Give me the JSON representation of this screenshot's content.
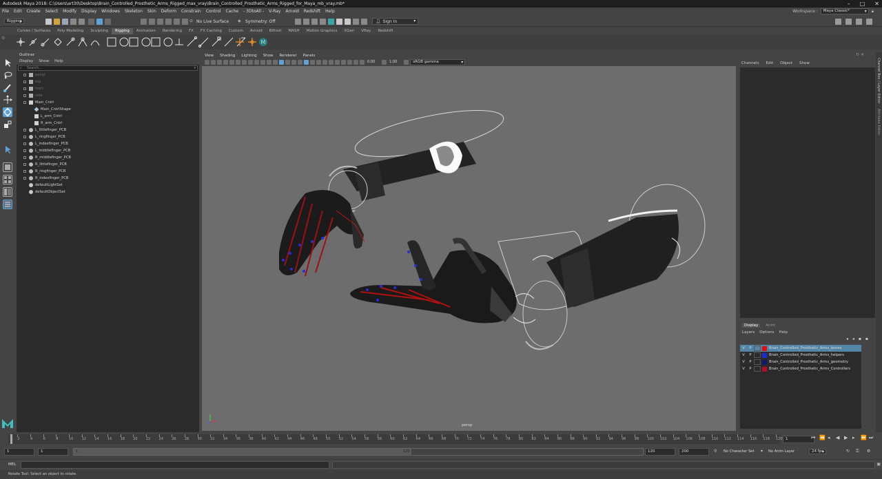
{
  "window": {
    "title": "Autodesk Maya 2018: C:\\Users\\art30\\Desktop\\Brain_Controlled_Prosthetic_Arms_Rigged_max_vray\\Brain_Controlled_Prosthetic_Arms_Rigged_for_Maya_mb_vray.mb*"
  },
  "menus": [
    "File",
    "Edit",
    "Create",
    "Select",
    "Modify",
    "Display",
    "Windows",
    "Skeleton",
    "Skin",
    "Deform",
    "Constrain",
    "Control",
    "Cache",
    "- 3DtoAll -",
    "V-Ray",
    "Arnold",
    "Redshift",
    "Help"
  ],
  "workspace": {
    "label": "Workspace :",
    "value": "Maya Classic*"
  },
  "status_line": {
    "menu_set": "Rigging",
    "live_surface": "No Live Surface",
    "symmetry": "Symmetry: Off",
    "sign_in": "Sign In"
  },
  "shelf_tabs": [
    "Curves / Surfaces",
    "Poly Modeling",
    "Sculpting",
    "Rigging",
    "Animation",
    "Rendering",
    "FX",
    "FX Caching",
    "Custom",
    "Arnold",
    "Bifrost",
    "MASH",
    "Motion Graphics",
    "XGen",
    "VRay",
    "Redshift"
  ],
  "shelf_active": "Rigging",
  "outliner": {
    "title": "Outliner",
    "menu": [
      "Display",
      "Show",
      "Help"
    ],
    "search_placeholder": "Search...",
    "items": [
      {
        "label": "persp",
        "dim": true,
        "indent": 0,
        "icon": "camera"
      },
      {
        "label": "top",
        "dim": true,
        "indent": 0,
        "icon": "camera"
      },
      {
        "label": "front",
        "dim": true,
        "indent": 0,
        "icon": "camera"
      },
      {
        "label": "side",
        "dim": true,
        "indent": 0,
        "icon": "camera"
      },
      {
        "label": "Main_Cntrl",
        "dim": false,
        "indent": 0,
        "icon": "curve",
        "expanded": true
      },
      {
        "label": "Main_CntrlShape",
        "dim": false,
        "indent": 1,
        "icon": "shape"
      },
      {
        "label": "L_arm_Cntrl",
        "dim": false,
        "indent": 1,
        "icon": "curve"
      },
      {
        "label": "R_arm_Cntrl",
        "dim": false,
        "indent": 1,
        "icon": "curve"
      },
      {
        "label": "L_littlefinger_PCB",
        "dim": false,
        "indent": 0,
        "icon": "constraint"
      },
      {
        "label": "L_ringfinger_PCB",
        "dim": false,
        "indent": 0,
        "icon": "constraint"
      },
      {
        "label": "L_indexfinger_PCB",
        "dim": false,
        "indent": 0,
        "icon": "constraint"
      },
      {
        "label": "L_middlefinger_PCB",
        "dim": false,
        "indent": 0,
        "icon": "constraint"
      },
      {
        "label": "R_middlefinger_PCB",
        "dim": false,
        "indent": 0,
        "icon": "constraint"
      },
      {
        "label": "R_littlefinger_PCB",
        "dim": false,
        "indent": 0,
        "icon": "constraint"
      },
      {
        "label": "R_ringfinger_PCB",
        "dim": false,
        "indent": 0,
        "icon": "constraint"
      },
      {
        "label": "R_indexfinger_PCB",
        "dim": false,
        "indent": 0,
        "icon": "constraint"
      },
      {
        "label": "defaultLightSet",
        "dim": false,
        "indent": 0,
        "icon": "set"
      },
      {
        "label": "defaultObjectSet",
        "dim": false,
        "indent": 0,
        "icon": "set"
      }
    ]
  },
  "viewport": {
    "menu": [
      "View",
      "Shading",
      "Lighting",
      "Show",
      "Renderer",
      "Panels"
    ],
    "exposure": "0.00",
    "gamma": "1.00",
    "color_space": "sRGB gamma",
    "camera_label": "persp"
  },
  "channel_box": {
    "menu": [
      "Channels",
      "Edit",
      "Object",
      "Show"
    ]
  },
  "side_tabs": [
    "Channel Box / Layer Editor",
    "Attribute Editor"
  ],
  "layer_editor": {
    "tabs": [
      "Display",
      "Anim"
    ],
    "menu": [
      "Layers",
      "Options",
      "Help"
    ],
    "layers": [
      {
        "v": "V",
        "p": "P",
        "name": "Brain_Controlled_Prosthetic_Arms_bones",
        "color": "#e01010",
        "selected": true
      },
      {
        "v": "V",
        "p": "P",
        "name": "Brain_Controlled_Prosthetic_Arms_helpers",
        "color": "#1a2bd6",
        "selected": false
      },
      {
        "v": "V",
        "p": "P",
        "name": "Brain_Controlled_Prosthetic_Arms_geometry",
        "color": "#101a70",
        "selected": false
      },
      {
        "v": "V",
        "p": "P",
        "name": "Brain_Controlled_Prosthetic_Arms_Controllers",
        "color": "#b0102a",
        "selected": false
      }
    ]
  },
  "time_slider": {
    "ticks": [
      1,
      2,
      4,
      6,
      8,
      10,
      12,
      14,
      16,
      18,
      20,
      22,
      24,
      26,
      28,
      30,
      32,
      34,
      36,
      38,
      40,
      42,
      44,
      46,
      48,
      50,
      52,
      54,
      56,
      58,
      60,
      62,
      64,
      66,
      68,
      70,
      72,
      74,
      76,
      78,
      80,
      82,
      84,
      86,
      88,
      90,
      92,
      94,
      96,
      98,
      100,
      102,
      104,
      106,
      108,
      110,
      112,
      114,
      116,
      118,
      120
    ],
    "current_frame": "1"
  },
  "range_slider": {
    "start": "1",
    "playback_start": "1",
    "range_start_label": "1",
    "range_end_label": "120",
    "playback_end": "120",
    "end": "200",
    "character_set": "No Character Set",
    "anim_layer": "No Anim Layer",
    "fps": "24 fps"
  },
  "command_line": {
    "label": "MEL"
  },
  "help_line": {
    "text": "Rotate Tool: Select an object to rotate."
  }
}
